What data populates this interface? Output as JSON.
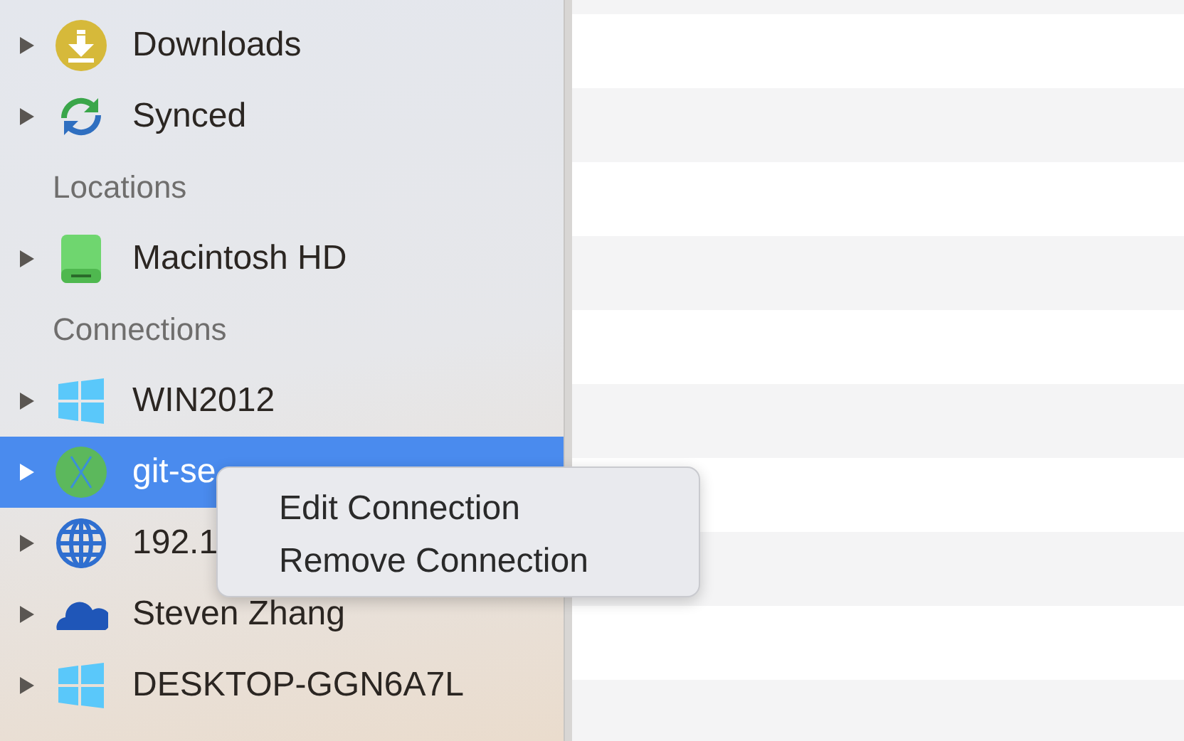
{
  "sidebar": {
    "items": [
      {
        "kind": "download",
        "label": "Downloads",
        "expanded": false,
        "selected": false
      },
      {
        "kind": "sync",
        "label": "Synced",
        "expanded": false,
        "selected": false
      },
      {
        "kind": "header",
        "label": "Locations"
      },
      {
        "kind": "disk",
        "label": "Macintosh HD",
        "expanded": false,
        "selected": false
      },
      {
        "kind": "header",
        "label": "Connections"
      },
      {
        "kind": "windows",
        "label": "WIN2012",
        "expanded": false,
        "selected": false
      },
      {
        "kind": "server",
        "label": "git-se",
        "expanded": false,
        "selected": true
      },
      {
        "kind": "globe",
        "label": "192.1",
        "expanded": false,
        "selected": false
      },
      {
        "kind": "cloud",
        "label": "Steven Zhang",
        "expanded": false,
        "selected": false
      },
      {
        "kind": "windows",
        "label": "DESKTOP-GGN6A7L",
        "expanded": false,
        "selected": false
      }
    ]
  },
  "context_menu": {
    "items": [
      "Edit Connection",
      "Remove Connection"
    ]
  }
}
